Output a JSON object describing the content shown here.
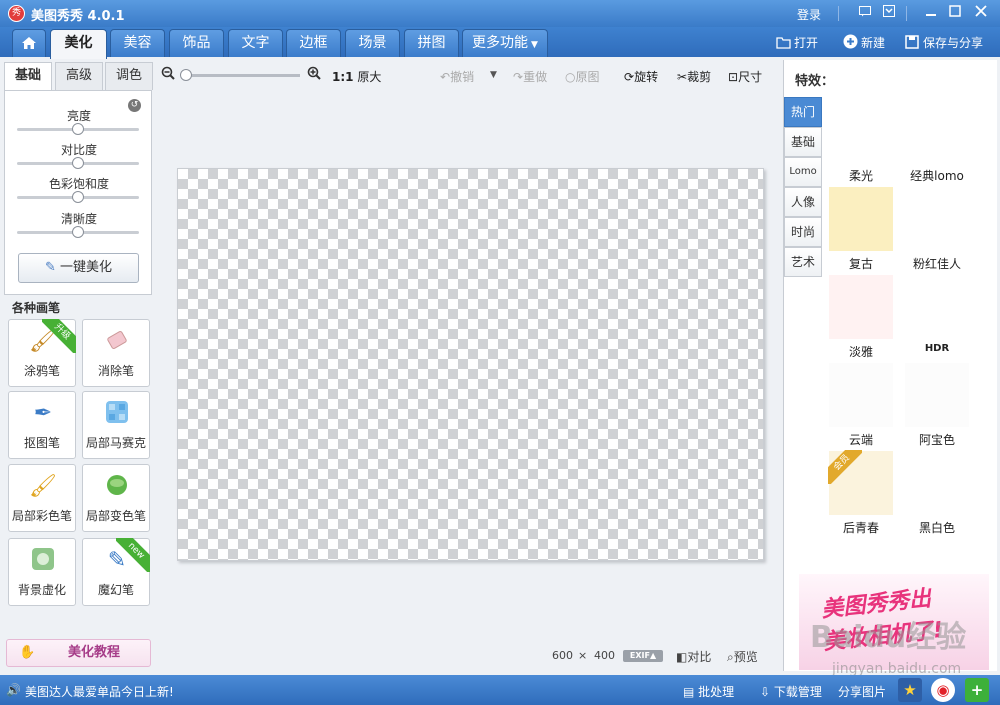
{
  "app": {
    "title": "美图秀秀 4.0.1",
    "logo_text": "秀",
    "login": "登录"
  },
  "colors": {
    "accent": "#3a7bc8",
    "active_cat": "#4a8ad4",
    "ribbon_green": "#47b035",
    "promo_pink": "#e8337c"
  },
  "tabs": [
    {
      "label": "",
      "icon": "home-icon"
    },
    {
      "label": "美化"
    },
    {
      "label": "美容"
    },
    {
      "label": "饰品"
    },
    {
      "label": "文字"
    },
    {
      "label": "边框"
    },
    {
      "label": "场景"
    },
    {
      "label": "拼图"
    },
    {
      "label": "更多功能"
    }
  ],
  "top_actions": {
    "open": "打开",
    "new": "新建",
    "save_share": "保存与分享"
  },
  "left": {
    "subtabs": [
      "基础",
      "高级",
      "调色"
    ],
    "sliders": [
      {
        "label": "亮度",
        "value": 0.5
      },
      {
        "label": "对比度",
        "value": 0.5
      },
      {
        "label": "色彩饱和度",
        "value": 0.5
      },
      {
        "label": "清晰度",
        "value": 0.5
      }
    ],
    "one_key": "一键美化",
    "brush_title": "各种画笔",
    "brushes": [
      {
        "label": "涂鸦笔",
        "ribbon": "升级"
      },
      {
        "label": "消除笔",
        "ribbon": ""
      },
      {
        "label": "抠图笔",
        "ribbon": ""
      },
      {
        "label": "局部马赛克",
        "ribbon": ""
      },
      {
        "label": "局部彩色笔",
        "ribbon": ""
      },
      {
        "label": "局部变色笔",
        "ribbon": ""
      },
      {
        "label": "背景虚化",
        "ribbon": ""
      },
      {
        "label": "魔幻笔",
        "ribbon": "new"
      }
    ],
    "tutorial": "美化教程"
  },
  "toolbar": {
    "zoom_ratio": "1:1",
    "original_size": "原大",
    "undo": "撤销",
    "redo": "重做",
    "original": "原图",
    "rotate": "旋转",
    "crop": "裁剪",
    "size": "尺寸"
  },
  "canvas": {
    "width": "600",
    "times": "×",
    "height": "400",
    "exif": "EXIF▲",
    "compare": "对比",
    "preview": "预览"
  },
  "effects": {
    "title": "特效：",
    "categories": [
      "热门",
      "基础",
      "Lomo",
      "人像",
      "时尚",
      "艺术"
    ],
    "items": [
      {
        "label": "柔光",
        "color": "#ffffff",
        "badge": ""
      },
      {
        "label": "经典lomo",
        "color": "#ffffff",
        "badge": ""
      },
      {
        "label": "复古",
        "color": "#fbefc0",
        "badge": ""
      },
      {
        "label": "粉红佳人",
        "color": "#ffffff",
        "badge": ""
      },
      {
        "label": "淡雅",
        "color": "#fff2f2",
        "badge": ""
      },
      {
        "label": "HDR",
        "color": "#ffffff",
        "badge": ""
      },
      {
        "label": "云端",
        "color": "#fcfcfc",
        "badge": ""
      },
      {
        "label": "阿宝色",
        "color": "#fcfcfc",
        "badge": ""
      },
      {
        "label": "后青春",
        "color": "#fbf3dd",
        "badge": "会员"
      },
      {
        "label": "黑白色",
        "color": "#ffffff",
        "badge": ""
      }
    ],
    "promo_line1": "美图秀秀出",
    "promo_line2": "美妆相机了!"
  },
  "watermark": {
    "text": "Baidu经验",
    "url": "jingyan.baidu.com"
  },
  "status": {
    "message": "美图达人最爱单品今日上新!",
    "batch": "批处理",
    "download": "下载管理",
    "share": "分享图片"
  }
}
